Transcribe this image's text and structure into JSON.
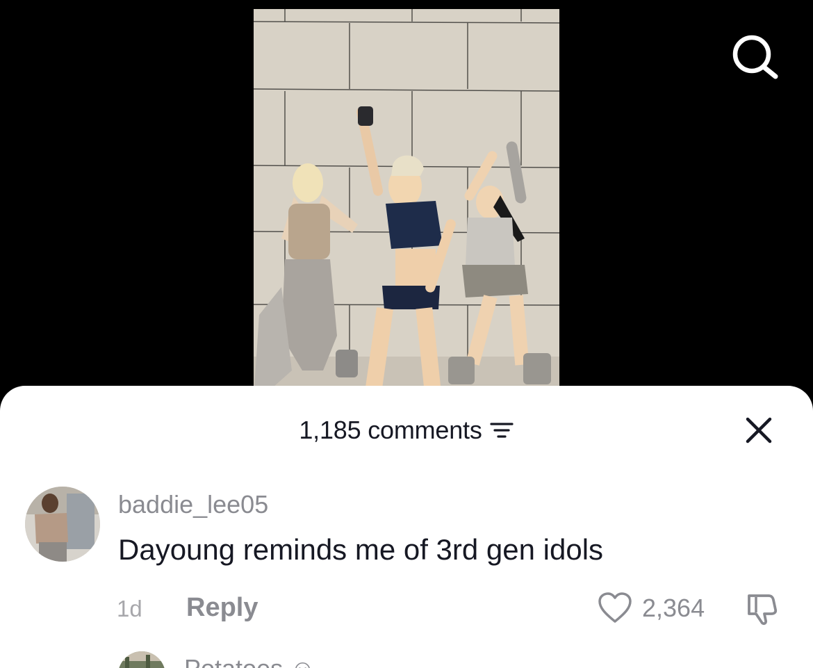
{
  "comments_sheet": {
    "count_label": "1,185 comments",
    "close_icon": "close-icon",
    "filter_icon": "filter-icon"
  },
  "top_bar": {
    "search_icon": "search-icon"
  },
  "comments": [
    {
      "username": "baddie_lee05",
      "text": "Dayoung reminds me of 3rd gen idols",
      "time": "1d",
      "reply_label": "Reply",
      "likes": "2,364"
    },
    {
      "username": "Potatoes"
    }
  ],
  "colors": {
    "text_primary": "#161823",
    "text_secondary": "#8a8b91"
  }
}
